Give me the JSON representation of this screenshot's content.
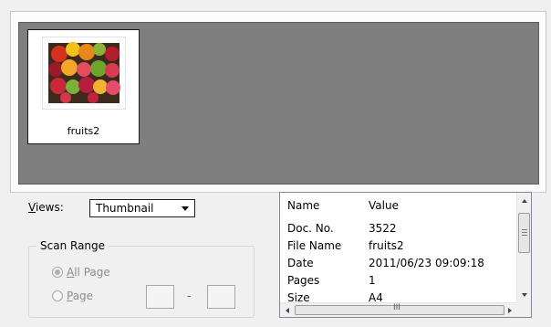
{
  "preview": {
    "thumbnails": [
      {
        "caption": "fruits2",
        "image": "fruits-photo"
      }
    ]
  },
  "views": {
    "label_prefix": "",
    "label_mnemonic": "V",
    "label_rest": "iews:",
    "selected": "Thumbnail"
  },
  "scan_range": {
    "title": "Scan Range",
    "all_page": {
      "mnemonic": "A",
      "rest": "ll Page",
      "checked": true,
      "enabled": false
    },
    "page": {
      "mnemonic": "P",
      "rest": "age",
      "checked": false,
      "enabled": false
    },
    "separator": "-"
  },
  "properties": {
    "columns": [
      "Name",
      "Value"
    ],
    "rows": [
      {
        "name": "Doc. No.",
        "value": "3522"
      },
      {
        "name": "File Name",
        "value": "fruits2"
      },
      {
        "name": "Date",
        "value": "2011/06/23 09:09:18"
      },
      {
        "name": "Pages",
        "value": "1"
      },
      {
        "name": "Size",
        "value": "A4"
      }
    ],
    "hscroll_grip": "III"
  },
  "colors": {
    "preview_background": "#7f7f7f",
    "disabled_text": "#8c8c8c"
  }
}
